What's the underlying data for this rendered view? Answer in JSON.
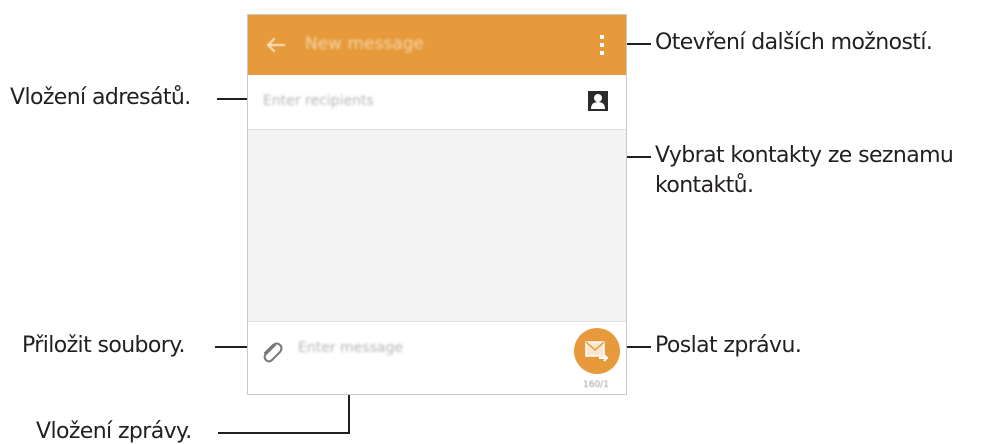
{
  "phone": {
    "header": {
      "title": "New message",
      "bg_color": "#e69a3b",
      "back_icon": "arrow-left-icon",
      "menu_icon": "more-vertical-icon"
    },
    "recipients": {
      "placeholder": "Enter recipients",
      "contact_icon": "contact-icon"
    },
    "composer": {
      "placeholder": "Enter message",
      "attach_icon": "paperclip-icon",
      "send_icon": "send-message-icon",
      "counter": "160/1"
    }
  },
  "callouts": {
    "more_options": "Otevření dalších možností.",
    "recipients": "Vložení adresátů.",
    "contacts_line1": "Vybrat kontakty ze seznamu",
    "contacts_line2": "kontaktů.",
    "attach": "Přiložit soubory.",
    "send": "Poslat zprávu.",
    "message": "Vložení zprávy."
  }
}
